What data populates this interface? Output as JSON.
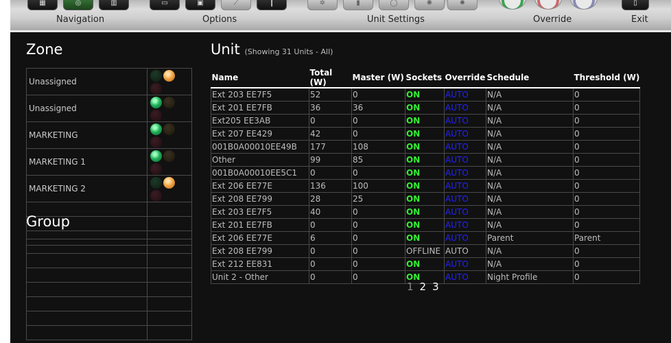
{
  "toolbar": {
    "labels": {
      "navigation": "Navigation",
      "options": "Options",
      "unit_settings": "Unit Settings",
      "override": "Override",
      "exit": "Exit"
    }
  },
  "zone": {
    "title": "Zone",
    "rows": [
      {
        "name": "Unassigned",
        "green": false,
        "orange": true
      },
      {
        "name": "Unassigned",
        "green": true,
        "orange": false
      },
      {
        "name": "MARKETING",
        "green": true,
        "orange": false
      },
      {
        "name": "MARKETING 1",
        "green": true,
        "orange": false
      },
      {
        "name": "MARKETING 2",
        "green": false,
        "orange": true
      },
      {
        "name": ""
      },
      {
        "name": ""
      },
      {
        "name": ""
      }
    ]
  },
  "group": {
    "title": "Group",
    "rows": [
      {
        "name": ""
      },
      {
        "name": ""
      },
      {
        "name": ""
      },
      {
        "name": ""
      },
      {
        "name": ""
      },
      {
        "name": ""
      },
      {
        "name": ""
      }
    ]
  },
  "unit": {
    "title": "Unit",
    "subtitle": "(Showing 31 Units - All)",
    "columns": [
      "Name",
      "Total (W)",
      "Master (W)",
      "Sockets",
      "Override",
      "Schedule",
      "Threshold (W)"
    ],
    "rows": [
      [
        "Ext 203 EE7F5",
        "52",
        "0",
        "ON",
        "AUTO",
        "N/A",
        "0"
      ],
      [
        "Ext 201 EE7FB",
        "36",
        "36",
        "ON",
        "AUTO",
        "N/A",
        "0"
      ],
      [
        "Ext205 EE3AB",
        "0",
        "0",
        "ON",
        "AUTO",
        "N/A",
        "0"
      ],
      [
        "Ext 207 EE429",
        "42",
        "0",
        "ON",
        "AUTO",
        "N/A",
        "0"
      ],
      [
        "001B0A00010EE49B",
        "177",
        "108",
        "ON",
        "AUTO",
        "N/A",
        "0"
      ],
      [
        "Other",
        "99",
        "85",
        "ON",
        "AUTO",
        "N/A",
        "0"
      ],
      [
        "001B0A00010EE5C1",
        "0",
        "0",
        "ON",
        "AUTO",
        "N/A",
        "0"
      ],
      [
        "Ext 206 EE77E",
        "136",
        "100",
        "ON",
        "AUTO",
        "N/A",
        "0"
      ],
      [
        "Ext 208 EE799",
        "28",
        "25",
        "ON",
        "AUTO",
        "N/A",
        "0"
      ],
      [
        "Ext 203 EE7F5",
        "40",
        "0",
        "ON",
        "AUTO",
        "N/A",
        "0"
      ],
      [
        "Ext 201 EE7FB",
        "0",
        "0",
        "ON",
        "AUTO",
        "N/A",
        "0"
      ],
      [
        "Ext 206 EE77E",
        "6",
        "0",
        "ON",
        "AUTO",
        "Parent",
        "Parent"
      ],
      [
        "Ext 208 EE799",
        "0",
        "0",
        "OFFLINE",
        "AUTO",
        "N/A",
        "0"
      ],
      [
        "Ext 212 EE831",
        "0",
        "0",
        "ON",
        "AUTO",
        "N/A",
        "0"
      ],
      [
        "Unit 2 - Other",
        "0",
        "0",
        "ON",
        "AUTO",
        "Night Profile",
        "0"
      ]
    ],
    "pages": [
      "1",
      "2",
      "3"
    ],
    "current_page": "1"
  },
  "colors": {
    "on": "#34ee34",
    "auto": "#2222ff",
    "panel_bg": "#111111",
    "grid": "#4a4a4a"
  }
}
